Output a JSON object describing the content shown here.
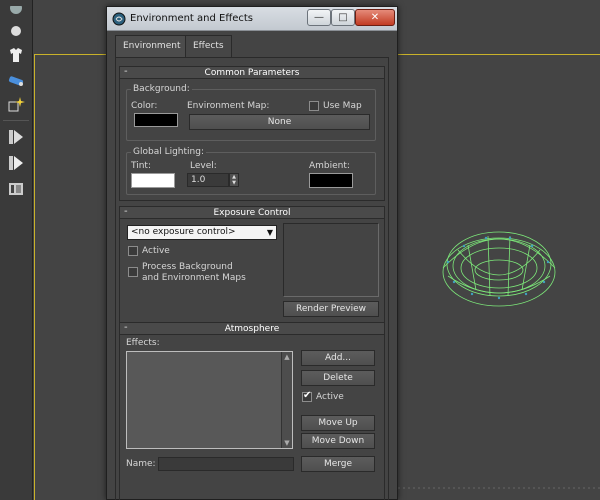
{
  "dialog": {
    "title": "Environment and Effects",
    "buttons": {
      "minimize": "—",
      "maximize": "□",
      "close": "✕"
    }
  },
  "tabs": [
    {
      "label": "Environment"
    },
    {
      "label": "Effects"
    }
  ],
  "common_parameters": {
    "header": "Common Parameters",
    "collapse_symbol": "-",
    "background": {
      "group_label": "Background:",
      "color_label": "Color:",
      "color_value": "#000000",
      "env_map_label": "Environment Map:",
      "use_map_label": "Use Map",
      "use_map_checked": false,
      "env_map_button": "None"
    },
    "global_lighting": {
      "group_label": "Global Lighting:",
      "tint_label": "Tint:",
      "tint_value": "#ffffff",
      "level_label": "Level:",
      "level_value": "1.0",
      "ambient_label": "Ambient:",
      "ambient_value": "#000000"
    }
  },
  "exposure_control": {
    "header": "Exposure Control",
    "collapse_symbol": "-",
    "dropdown_value": "<no exposure control>",
    "active_label": "Active",
    "active_checked": false,
    "process_label_line1": "Process Background",
    "process_label_line2": "and Environment Maps",
    "process_checked": false,
    "render_preview_button": "Render Preview"
  },
  "atmosphere": {
    "header": "Atmosphere",
    "collapse_symbol": "-",
    "effects_label": "Effects:",
    "add_button": "Add...",
    "delete_button": "Delete",
    "active_label": "Active",
    "active_checked": true,
    "move_up_button": "Move Up",
    "move_down_button": "Move Down",
    "name_label": "Name:",
    "name_value": "",
    "merge_button": "Merge"
  },
  "toolbar": {
    "icons": [
      "sphere-icon",
      "shirt-icon",
      "paint-icon",
      "sparkle-icon",
      "key-frame-icon",
      "play-icon",
      "film-icon"
    ]
  },
  "colors": {
    "viewport_border": "#c9b22a",
    "torus": "#7de87a",
    "ui_background": "#444444"
  }
}
